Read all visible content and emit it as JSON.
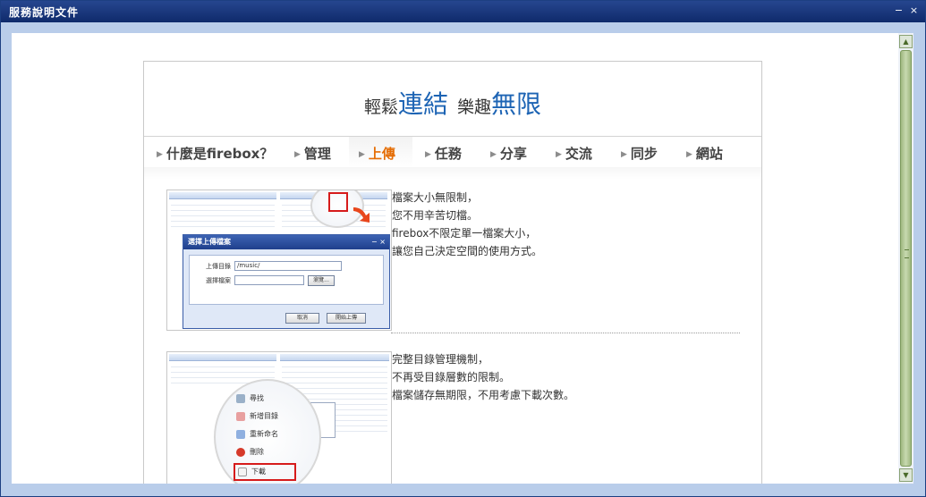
{
  "window": {
    "title": "服務說明文件",
    "minimize_label": "−",
    "close_label": "×"
  },
  "slogan": {
    "part1_small": "輕鬆",
    "part1_big": "連結",
    "part2_small": "樂趣",
    "part2_big": "無限"
  },
  "nav": {
    "items": [
      {
        "label": "什麼是firebox？",
        "active": false
      },
      {
        "label": "管理",
        "active": false
      },
      {
        "label": "上傳",
        "active": true
      },
      {
        "label": "任務",
        "active": false
      },
      {
        "label": "分享",
        "active": false
      },
      {
        "label": "交流",
        "active": false
      },
      {
        "label": "同步",
        "active": false
      },
      {
        "label": "網站",
        "active": false
      }
    ],
    "active_color": "#e56e06"
  },
  "section1": {
    "lines": [
      "檔案大小無限制，",
      "您不用辛苦切檔。",
      "firebox不限定單一檔案大小，",
      "讓您自己決定空間的使用方式。"
    ],
    "dialog": {
      "title": "選擇上傳檔案",
      "close": "− ×",
      "dir_label": "上傳目錄",
      "dir_value": "/music/",
      "file_label": "選擇檔案",
      "browse": "瀏覽...",
      "cancel": "取消",
      "start": "開始上傳"
    }
  },
  "section2": {
    "lines": [
      "完整目錄管理機制，",
      "不再受目錄層數的限制。",
      "檔案儲存無期限，不用考慮下載次數。"
    ],
    "menu": [
      "尋找",
      "新增目錄",
      "重新命名",
      "刪除",
      "下載"
    ]
  },
  "scrollbar": {
    "up_icon": "▲",
    "down_icon": "▼"
  },
  "colors": {
    "titlebar": "#1b3a7e",
    "accent_blue": "#1d64b4",
    "highlight_red": "#d61b1b"
  }
}
